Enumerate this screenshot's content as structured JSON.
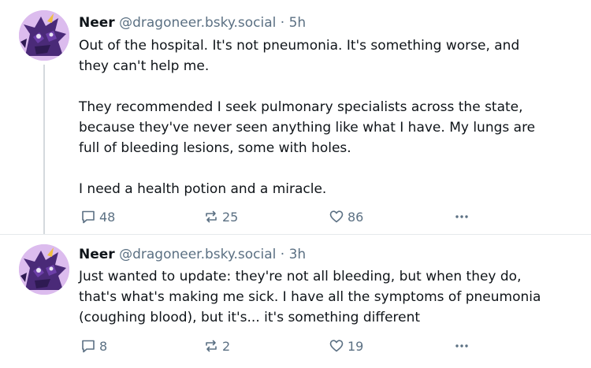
{
  "posts": [
    {
      "author": "Neer",
      "handle": "@dragoneer.bsky.social",
      "separator": "·",
      "time": "5h",
      "paragraphs": [
        "Out of the hospital. It's not pneumonia. It's something worse, and\nthey can't help me.",
        "They recommended I seek pulmonary specialists across the state,\nbecause they've never seen anything like what I have. My lungs are\nfull of bleeding lesions, some with holes.",
        "I need a health potion and a miracle."
      ],
      "replies": "48",
      "reposts": "25",
      "likes": "86"
    },
    {
      "author": "Neer",
      "handle": "@dragoneer.bsky.social",
      "separator": "·",
      "time": "3h",
      "paragraphs": [
        "Just wanted to update: they're not all bleeding, but when they do,\nthat's what's making me sick. I have all the symptoms of pneumonia\n(coughing blood), but it's... it's something different"
      ],
      "replies": "8",
      "reposts": "2",
      "likes": "19"
    }
  ],
  "icons": {
    "reply": "speech-bubble-icon",
    "repost": "repost-arrows-icon",
    "like": "heart-icon",
    "more": "ellipsis-icon",
    "avatar": "purple-dragon-avatar"
  },
  "colors": {
    "text": "#0f1419",
    "muted": "#5b7083",
    "thread_line": "#d4d9de",
    "avatar_bg": "#d9b8ec",
    "avatar_dragon": "#4a2a78"
  }
}
